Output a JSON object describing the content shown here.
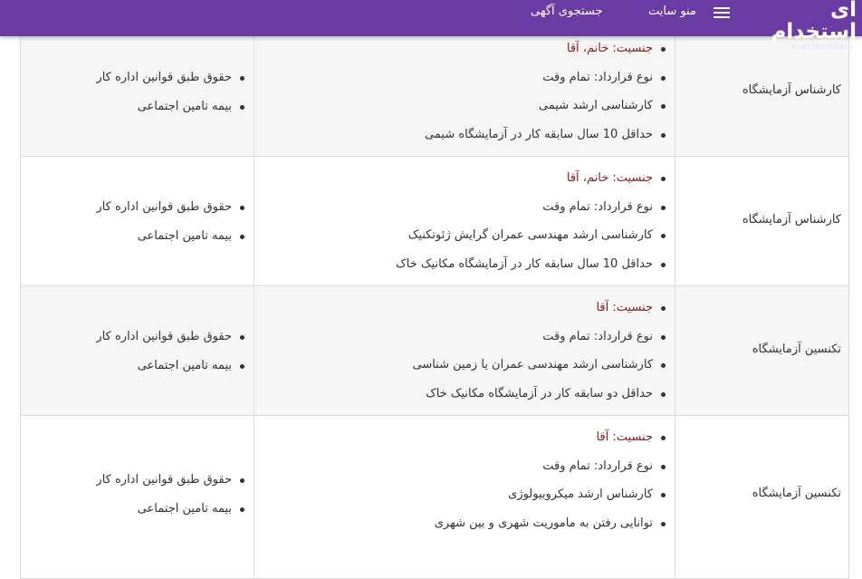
{
  "header": {
    "logo_text": "ای استخدام",
    "logo_subtext": "e-estekhdam",
    "menu_label": "منو سایت",
    "search_label": "جستجوی آگهی",
    "background_color": "#6a3ba3"
  },
  "table": {
    "rows": [
      {
        "title": "کارشناس آزمایشگاه",
        "requirements": [
          "جنسیت: خانم، آقا",
          "نوع قرارداد: تمام وقت",
          "کارشناسی ارشد شیمی",
          "حداقل 10 سال سابقه کار در آزمایشگاه شیمی"
        ],
        "benefits": [
          "حقوق طبق قوانین اداره کار",
          "بیمه تامین اجتماعی"
        ]
      },
      {
        "title": "کارشناس آزمایشگاه",
        "requirements": [
          "جنسیت: خانم، آقا",
          "نوع قرارداد: تمام وقت",
          "کارشناسی ارشد مهندسی عمران گرایش ژئوتکنیک",
          "حداقل 10 سال سابقه کار در آزمایشگاه مکانیک خاک"
        ],
        "benefits": [
          "حقوق طبق قوانین اداره کار",
          "بیمه تامین اجتماعی"
        ]
      },
      {
        "title": "تکنسین آزمایشگاه",
        "requirements": [
          "جنسیت: آقا",
          "نوع قرارداد: تمام وقت",
          "کارشناسی ارشد مهندسی عمران یا زمین شناسی",
          "حداقل دو سابقه کار در آزمایشگاه مکانیک خاک"
        ],
        "benefits": [
          "حقوق طبق قوانین اداره کار",
          "بیمه تامین اجتماعی"
        ]
      },
      {
        "title": "تکنسین آزمایشگاه",
        "requirements": [
          "جنسیت: آقا",
          "نوع قرارداد: تمام وقت",
          "کارشناس ارشد میکروبیولوژی",
          "توانایی رفتن به ماموریت شهری و بین شهری"
        ],
        "benefits": [
          "حقوق طبق قوانین اداره کار",
          "بیمه تامین اجتماعی"
        ]
      }
    ],
    "accent_color": "#8b1a1a"
  }
}
